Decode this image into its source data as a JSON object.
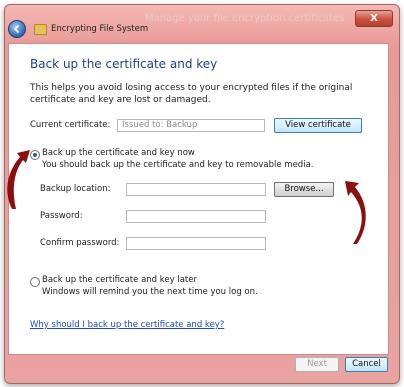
{
  "window": {
    "faint_title": "Manage your file encryption certificates",
    "close_glyph": "X"
  },
  "nav": {
    "title": "Encrypting File System",
    "back_icon": "back-arrow-icon",
    "folder_icon": "folder-key-icon"
  },
  "page": {
    "heading": "Back up the certificate and key",
    "intro": "This helps you avoid losing access to your encrypted files if the original certificate and key are lost or damaged."
  },
  "certificate": {
    "label": "Current certificate:",
    "value": "Issued to: Backup",
    "view_button": "View certificate"
  },
  "option_now": {
    "title": "Back up the certificate and key now",
    "description": "You should back up the certificate and key to removable media.",
    "selected": true
  },
  "backup": {
    "location_label": "Backup location:",
    "location_value": "",
    "browse_button": "Browse...",
    "password_label": "Password:",
    "password_value": "",
    "confirm_label": "Confirm password:",
    "confirm_value": ""
  },
  "option_later": {
    "title": "Back up the certificate and key later",
    "description": "Windows will remind you the next time you log on.",
    "selected": false
  },
  "help_link": "Why should I back up the certificate and key?",
  "footer": {
    "next_button": "Next",
    "cancel_button": "Cancel"
  },
  "colors": {
    "frame": "#e9a3a0",
    "heading": "#1e3f93",
    "link": "#1b49c7",
    "annotation_arrow": "#8b0f0f"
  }
}
